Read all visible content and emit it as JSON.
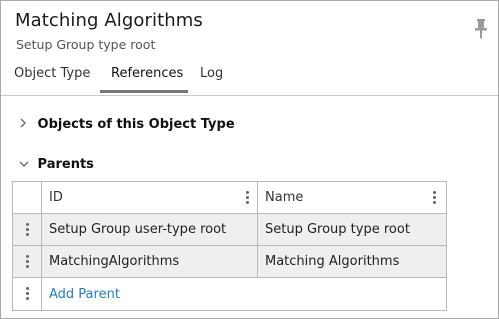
{
  "header": {
    "title": "Matching Algorithms",
    "subtitle": "Setup Group type root"
  },
  "tabs": [
    {
      "label": "Object Type",
      "active": false
    },
    {
      "label": "References",
      "active": true
    },
    {
      "label": "Log",
      "active": false
    }
  ],
  "sections": {
    "objects_of_type": {
      "label": "Objects of this Object Type",
      "expanded": false
    },
    "parents": {
      "label": "Parents",
      "expanded": true
    }
  },
  "parents_table": {
    "columns": [
      "ID",
      "Name"
    ],
    "rows": [
      {
        "id": "Setup Group user-type root",
        "name": "Setup Group type root"
      },
      {
        "id": "MatchingAlgorithms",
        "name": "Matching Algorithms"
      }
    ],
    "add_label": "Add Parent"
  },
  "colors": {
    "link": "#1f7fc1",
    "row_background": "#efefef",
    "active_tab_underline": "#777777"
  },
  "icons": {
    "pin": "pin-icon",
    "collapsed": "chevron-right-icon",
    "expanded": "chevron-down-icon",
    "row_menu": "kebab-icon"
  }
}
